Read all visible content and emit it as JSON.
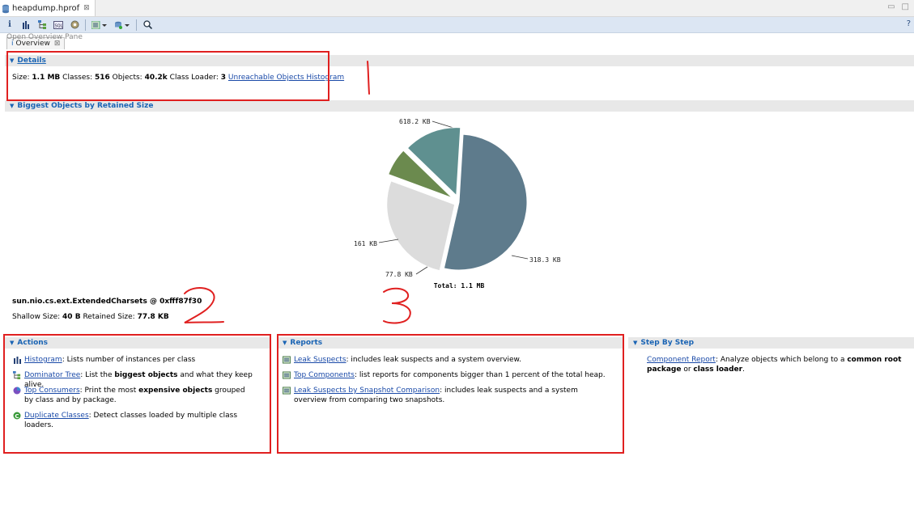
{
  "editor_tab": {
    "title": "heapdump.hprof",
    "close": "⊠"
  },
  "toolbar": {
    "tooltip": "Open Overview Pane",
    "help": "?"
  },
  "overview_tab": {
    "title": "Overview",
    "close": "⊠"
  },
  "details": {
    "title": "Details",
    "size_label": "Size:",
    "size_value": "1.1 MB",
    "classes_label": "Classes:",
    "classes_value": "516",
    "objects_label": "Objects:",
    "objects_value": "40.2k",
    "loader_label": "Class Loader:",
    "loader_value": "3",
    "unreachable_link": "Unreachable Objects Histogram"
  },
  "biggest": {
    "title": "Biggest Objects by Retained Size"
  },
  "chart_data": {
    "type": "pie",
    "unit": "KB",
    "slices": [
      {
        "label": "618.2 KB",
        "value": 618.2,
        "color": "#5e7b8c"
      },
      {
        "label": "318.3 KB",
        "value": 318.3,
        "color": "#dcdcdc"
      },
      {
        "label": "77.8 KB",
        "value": 77.8,
        "color": "#6b8a4e"
      },
      {
        "label": "161 KB",
        "value": 161,
        "color": "#5f9090"
      }
    ],
    "total": "Total: 1.1 MB"
  },
  "selected_object": {
    "name": "sun.nio.cs.ext.ExtendedCharsets @ 0xfff87f30",
    "shallow_label": "Shallow Size:",
    "shallow_value": "40 B",
    "retained_label": "Retained Size:",
    "retained_value": "77.8 KB"
  },
  "actions": {
    "title": "Actions",
    "items": [
      {
        "link": "Histogram",
        "text": ": Lists number of instances per class"
      },
      {
        "link": "Dominator Tree",
        "text_pre": ": List the ",
        "bold": "biggest objects",
        "text_post": " and what they keep alive."
      },
      {
        "link": "Top Consumers",
        "text_pre": ": Print the most ",
        "bold": "expensive objects",
        "text_post": " grouped by class and by package."
      },
      {
        "link": "Duplicate Classes",
        "text": ": Detect classes loaded by multiple class loaders."
      }
    ]
  },
  "reports": {
    "title": "Reports",
    "items": [
      {
        "link": "Leak Suspects",
        "text": ": includes leak suspects and a system overview."
      },
      {
        "link": "Top Components",
        "text": ": list reports for components bigger than 1 percent of the total heap."
      },
      {
        "link": "Leak Suspects by Snapshot Comparison",
        "text": ": includes leak suspects and a system overview from comparing two snapshots."
      }
    ]
  },
  "step_by_step": {
    "title": "Step By Step",
    "link": "Component Report",
    "text_pre": ": Analyze objects which belong to a ",
    "bold1": "common root package",
    "text_mid": " or ",
    "bold2": "class loader",
    "text_post": "."
  },
  "annotations": {
    "n1": "1",
    "n2": "2",
    "n3": "3"
  },
  "colors": {
    "accent": "#1a64b4",
    "annotation": "#e02020"
  }
}
